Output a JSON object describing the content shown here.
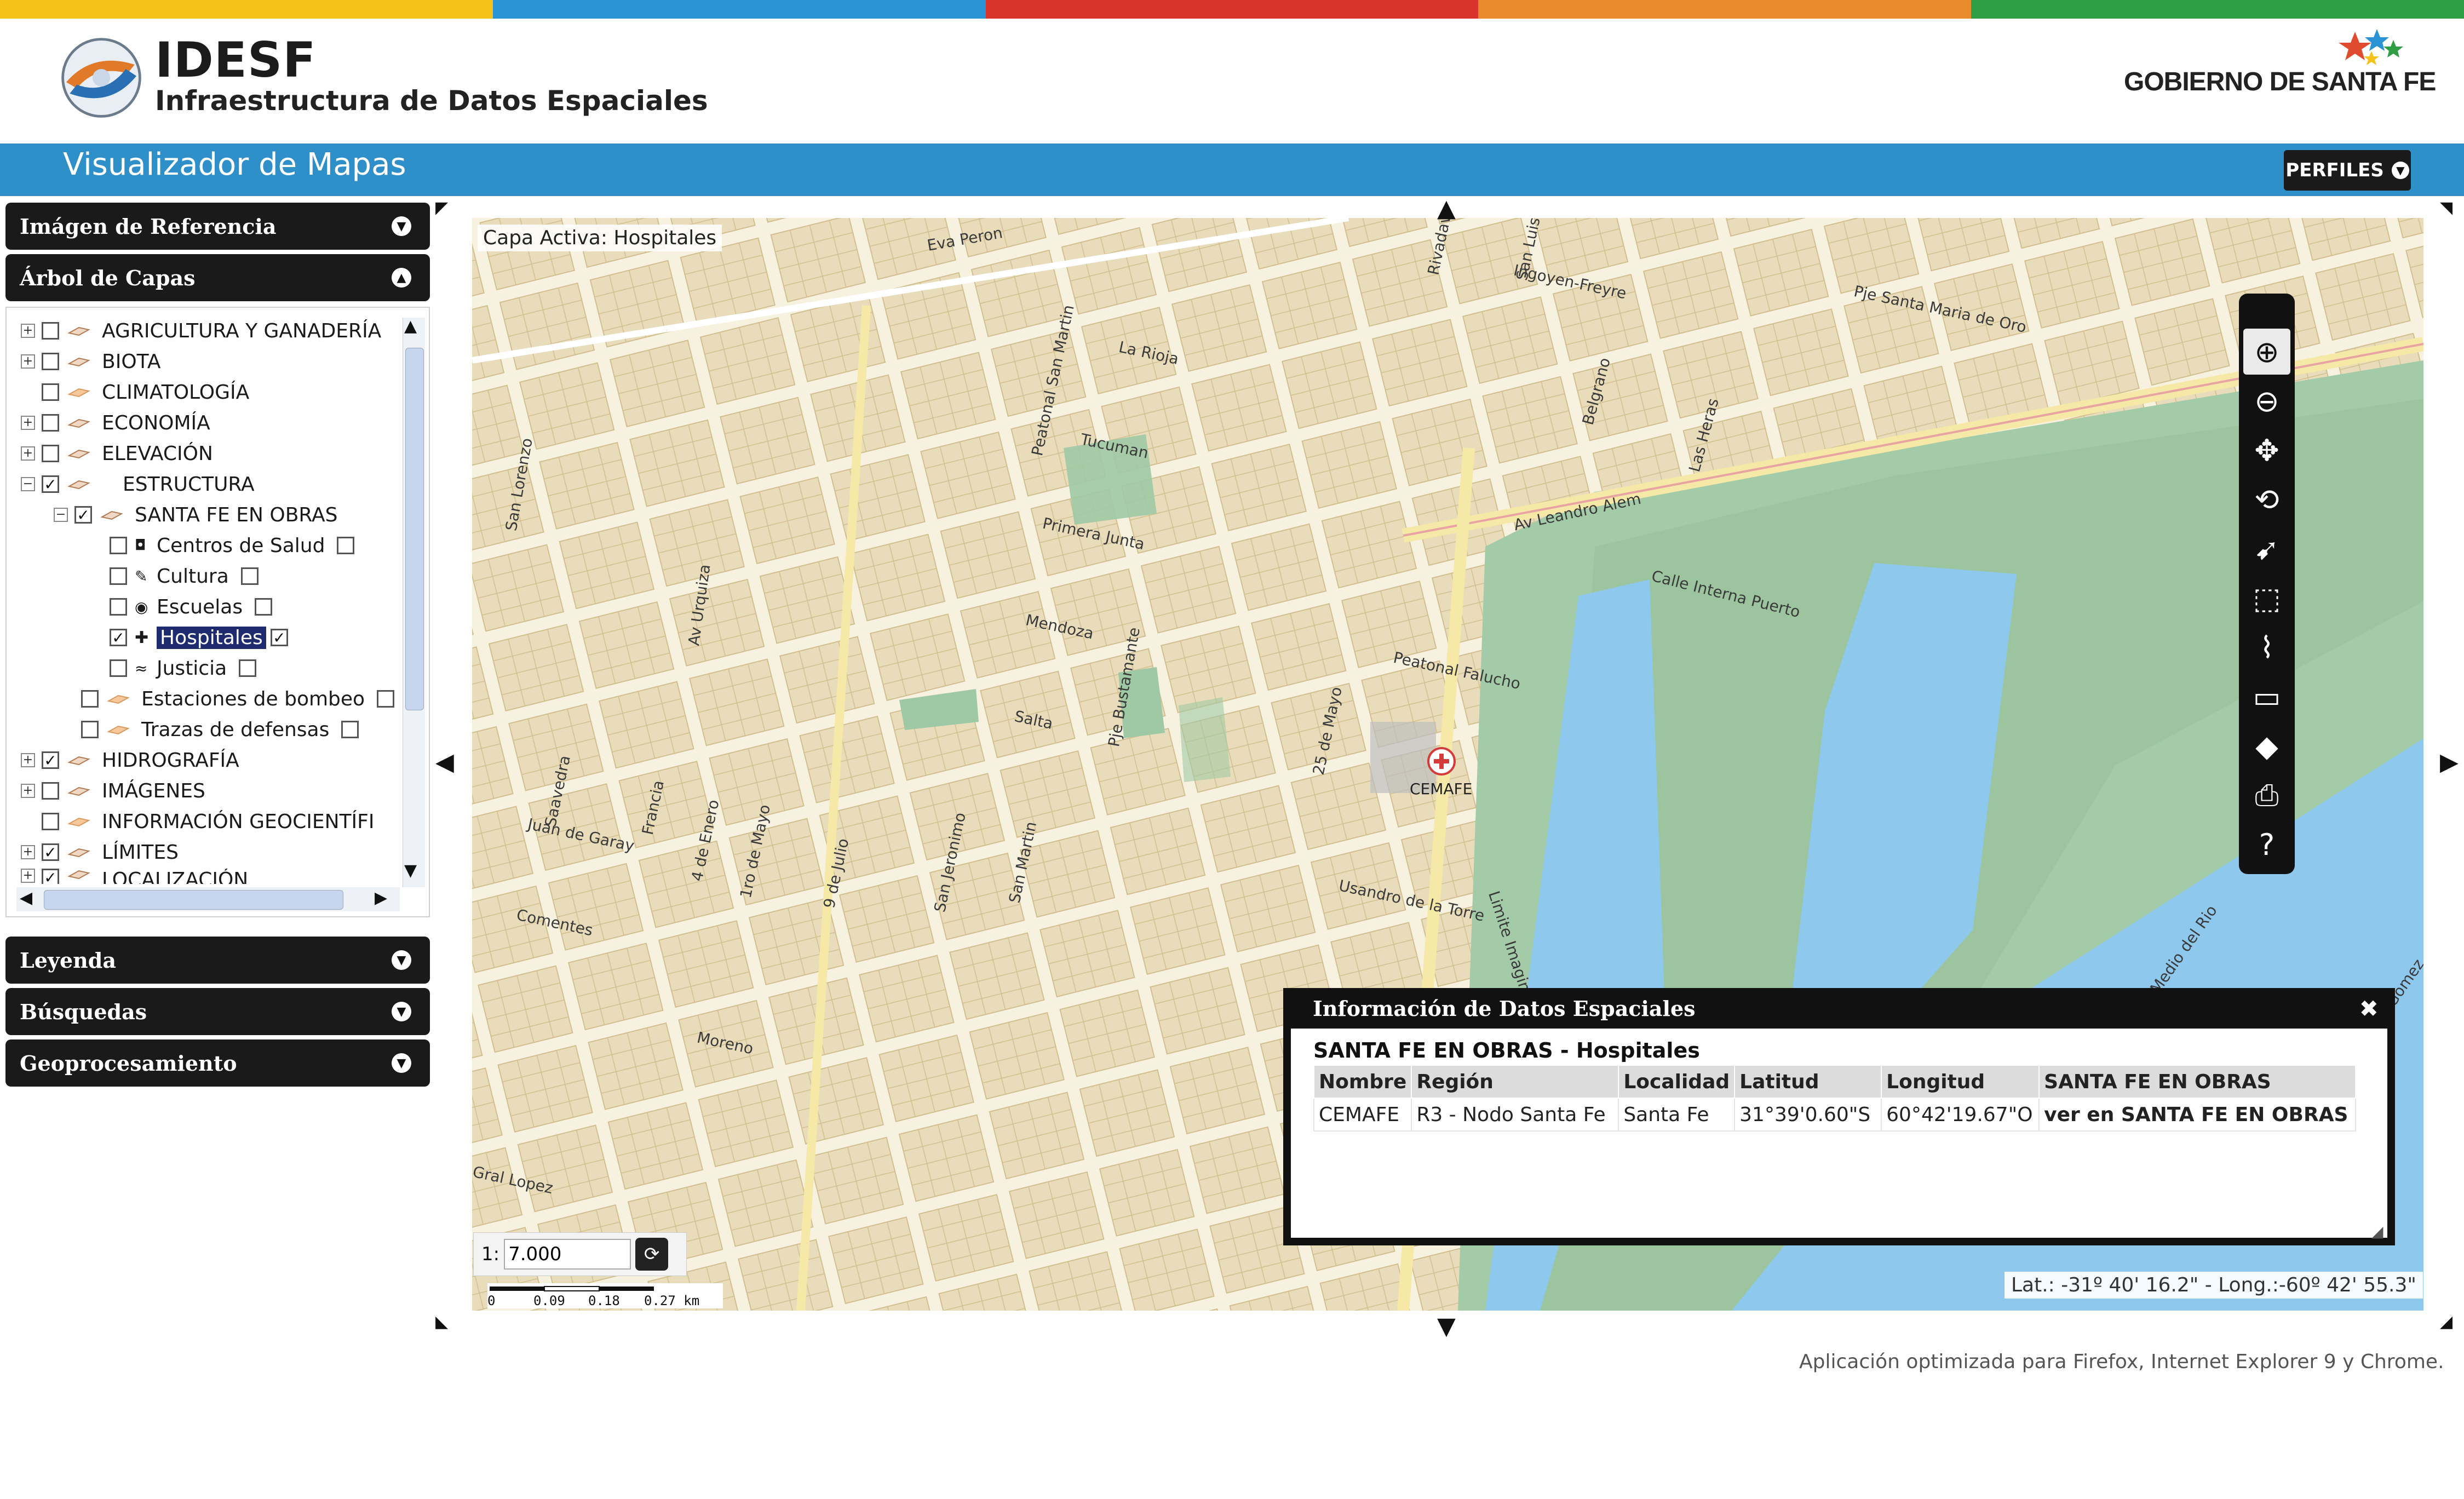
{
  "colors": {
    "stripe": [
      "#f4c218",
      "#2a93d5",
      "#d9342b",
      "#ea8a2c",
      "#2f9e44"
    ],
    "header_bar": "#2f8fc9",
    "dark_panel": "#1a1a1a",
    "map_water": "#8ec8ec",
    "map_park": "#9fc9a4"
  },
  "header": {
    "brand": "IDESF",
    "brand_subtitle": "Infraestructura de Datos Espaciales",
    "government": "GOBIERNO DE SANTA FE",
    "logo_icon": "globe-arrows-icon",
    "gov_logo_icon": "star-burst-icon"
  },
  "appbar": {
    "title": "Visualizador de Mapas",
    "profiles_button": "PERFILES"
  },
  "sidebar": {
    "reference_image": "Imágen de Referencia",
    "layer_tree": "Árbol de Capas",
    "legend": "Leyenda",
    "searches": "Búsquedas",
    "geoprocessing": "Geoprocesamiento",
    "tree_items": [
      {
        "label": "AGRICULTURA Y GANADERÍA",
        "checked": false
      },
      {
        "label": "BIOTA",
        "checked": false
      },
      {
        "label": "CLIMATOLOGÍA",
        "checked": false
      },
      {
        "label": "ECONOMÍA",
        "checked": false
      },
      {
        "label": "ELEVACIÓN",
        "checked": false
      },
      {
        "label": "ESTRUCTURA",
        "checked": true
      },
      {
        "label": "SANTA FE EN OBRAS",
        "checked": true
      },
      {
        "label": "Centros de Salud",
        "checked": false
      },
      {
        "label": "Cultura",
        "checked": false
      },
      {
        "label": "Escuelas",
        "checked": false
      },
      {
        "label": "Hospitales",
        "checked": true
      },
      {
        "label": "Justicia",
        "checked": false
      },
      {
        "label": "Estaciones de bombeo",
        "checked": false
      },
      {
        "label": "Trazas de defensas",
        "checked": false
      },
      {
        "label": "HIDROGRAFÍA",
        "checked": true
      },
      {
        "label": "IMÁGENES",
        "checked": false
      },
      {
        "label": "INFORMACIÓN GEOCIENTÍFI",
        "checked": false
      },
      {
        "label": "LÍMITES",
        "checked": true
      },
      {
        "label": "LOCALIZACIÓN",
        "checked": true
      }
    ]
  },
  "map": {
    "active_layer": "Capa Activa: Hospitales",
    "marker_label": "CEMAFE",
    "scale_prefix": "1:",
    "scale_value": "7.000",
    "scalebar_ticks": [
      "0",
      "0.09",
      "0.18",
      "0.27 km"
    ],
    "coordinates": "Lat.: -31º 40' 16.2\" - Long.:-60º 42' 55.3\"",
    "street_labels": [
      "Eva Peron",
      "La Rioja",
      "Tucuman",
      "Primera Junta",
      "Mendoza",
      "Salta",
      "Av Urquiza",
      "Av Leandro Alem",
      "Calle Interna Puerto",
      "Peatonal Falucho",
      "Usandro de la Torre",
      "Juan de Garay",
      "Comentes",
      "Moreno",
      "San Lorenzo",
      "Ingoyen-Freyre",
      "Limite Imaginario",
      "Eje Medio del Rio",
      "Pje Santa Maria de Oro",
      "Belgrano",
      "Las Heras",
      "Saavedra",
      "Francia",
      "1ro de Mayo",
      "9 de Julio",
      "San Jeronimo",
      "San Martin",
      "Peatonal San Martin",
      "25 de Mayo",
      "4 de Enero",
      "Pje Bustamante",
      "Gral Lopez",
      "Rivadavia",
      "San Luis",
      "Gomez"
    ],
    "toolbar": [
      "zoom-in-icon",
      "zoom-out-icon",
      "pan-icon",
      "full-extent-icon",
      "identify-icon",
      "select-info-icon",
      "measure-icon",
      "ruler-icon",
      "erase-icon",
      "print-icon",
      "help-icon"
    ]
  },
  "info_popup": {
    "title": "Información de Datos Espaciales",
    "subtitle": "SANTA FE EN OBRAS - Hospitales",
    "columns": [
      "Nombre",
      "Región",
      "Localidad",
      "Latitud",
      "Longitud",
      "SANTA FE EN OBRAS"
    ],
    "rows": [
      [
        "CEMAFE",
        "R3 - Nodo Santa Fe",
        "Santa Fe",
        "31°39'0.60\"S",
        "60°42'19.67\"O",
        "ver en SANTA FE EN OBRAS"
      ]
    ]
  },
  "footer": {
    "note": "Aplicación optimizada para Firefox, Internet Explorer 9 y Chrome."
  }
}
